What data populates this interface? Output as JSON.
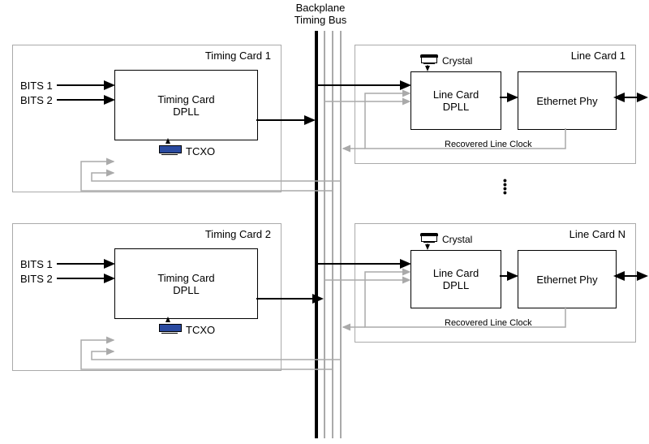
{
  "bus_title_line1": "Backplane",
  "bus_title_line2": "Timing Bus",
  "timing_cards": [
    {
      "title": "Timing Card 1",
      "dpll_line1": "Timing Card",
      "dpll_line2": "DPLL",
      "input1": "BITS 1",
      "input2": "BITS 2",
      "tcxo_label": "TCXO"
    },
    {
      "title": "Timing Card 2",
      "dpll_line1": "Timing Card",
      "dpll_line2": "DPLL",
      "input1": "BITS 1",
      "input2": "BITS 2",
      "tcxo_label": "TCXO"
    }
  ],
  "line_cards": [
    {
      "title": "Line Card 1",
      "dpll_line1": "Line Card",
      "dpll_line2": "DPLL",
      "phy_label": "Ethernet Phy",
      "crystal_label": "Crystal",
      "recovered_label": "Recovered Line Clock"
    },
    {
      "title": "Line Card N",
      "dpll_line1": "Line Card",
      "dpll_line2": "DPLL",
      "phy_label": "Ethernet Phy",
      "crystal_label": "Crystal",
      "recovered_label": "Recovered Line Clock"
    }
  ]
}
